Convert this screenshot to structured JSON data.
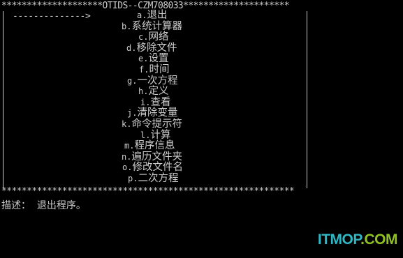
{
  "top_border": "********************OTIDS--CZM708033*********************",
  "arrow": "-------------->",
  "menu": [
    {
      "key": "a.",
      "label": "退出"
    },
    {
      "key": "b.",
      "label": "系统计算器"
    },
    {
      "key": "c.",
      "label": "网络"
    },
    {
      "key": "d.",
      "label": "移除文件"
    },
    {
      "key": "e.",
      "label": "设置"
    },
    {
      "key": "f.",
      "label": "时间"
    },
    {
      "key": "g.",
      "label": "一次方程"
    },
    {
      "key": "h.",
      "label": "定义"
    },
    {
      "key": "i.",
      "label": "查看"
    },
    {
      "key": "j.",
      "label": "清除变量"
    },
    {
      "key": "k.",
      "label": "命令提示符"
    },
    {
      "key": "l.",
      "label": "计算"
    },
    {
      "key": "m.",
      "label": "程序信息"
    },
    {
      "key": "n.",
      "label": "遍历文件夹"
    },
    {
      "key": "o.",
      "label": "修改文件名"
    },
    {
      "key": "p.",
      "label": "二次方程"
    }
  ],
  "bottom_border": "**********************************************************",
  "description": "描述：  退出程序。",
  "watermark": {
    "part1": "ITMOP",
    "part2": ".COM"
  },
  "colors": {
    "background": "#000000",
    "text": "#cccccc",
    "watermark_blue": "#2fb8c4",
    "watermark_green": "#8fc31f"
  }
}
